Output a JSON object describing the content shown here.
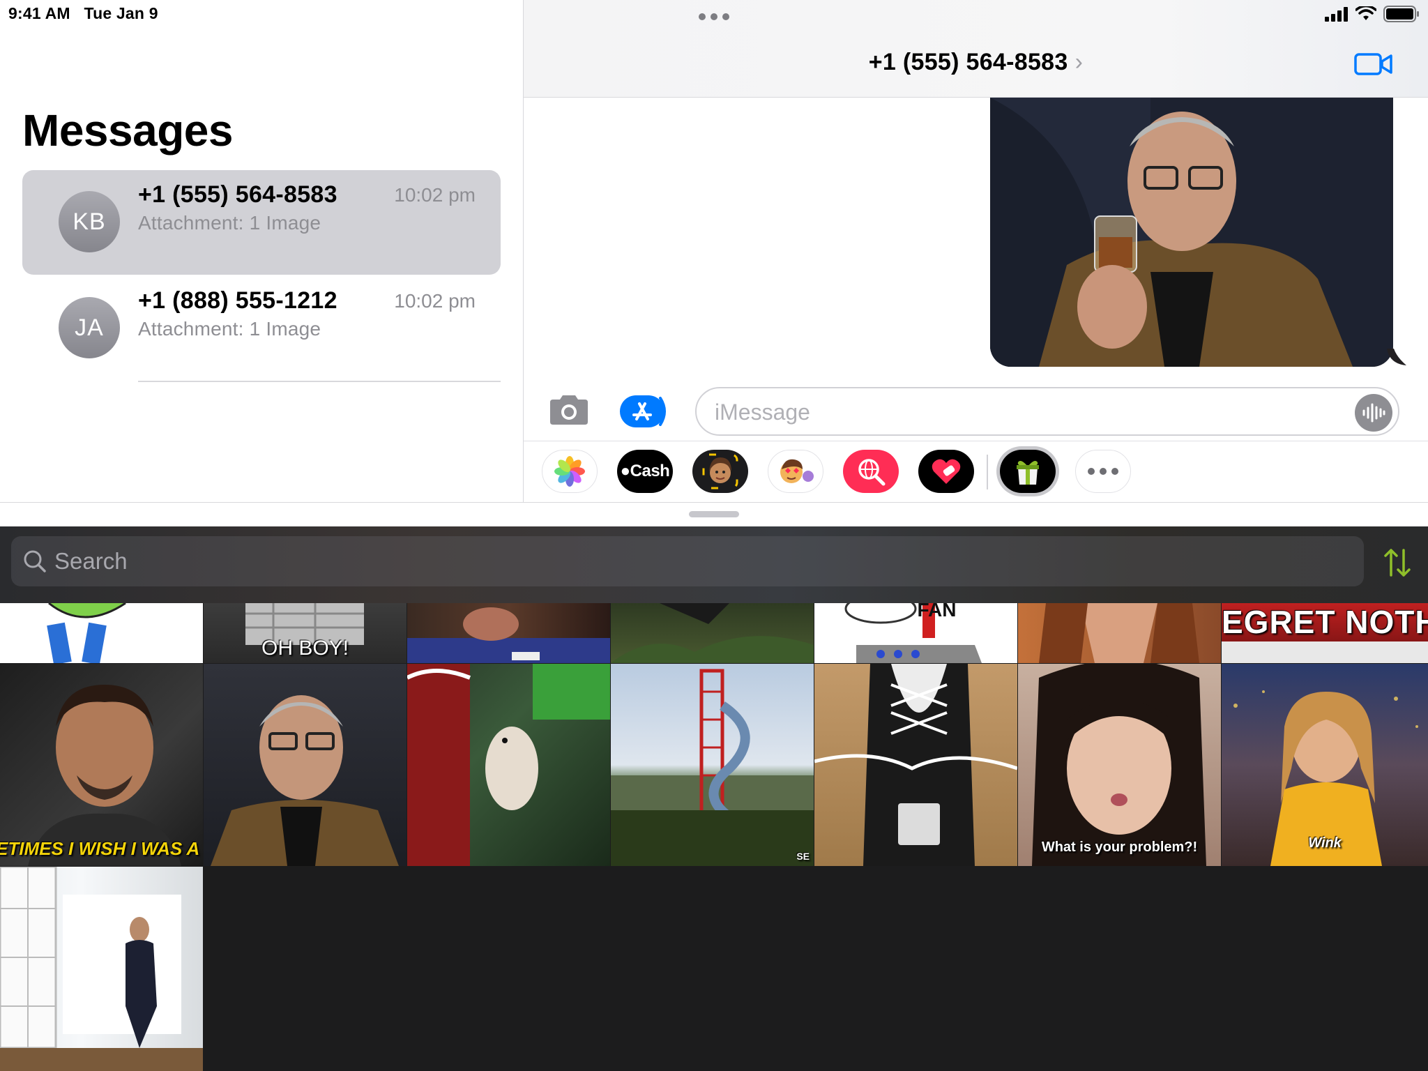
{
  "status_bar": {
    "time": "9:41 AM",
    "date": "Tue Jan 9",
    "icons": [
      "cellular-signal-icon",
      "wifi-icon",
      "battery-icon"
    ]
  },
  "sidebar": {
    "title": "Messages",
    "conversations": [
      {
        "initials": "KB",
        "name": "+1 (555) 564-8583",
        "time": "10:02 pm",
        "preview": "Attachment: 1 Image",
        "selected": true
      },
      {
        "initials": "JA",
        "name": "+1 (888) 555-1212",
        "time": "10:02 pm",
        "preview": "Attachment: 1 Image",
        "selected": false
      }
    ]
  },
  "conversation": {
    "title": "+1 (555) 564-8583",
    "title_chevron": "›",
    "input_placeholder": "iMessage",
    "apps": [
      {
        "name": "photos-app-icon"
      },
      {
        "name": "apple-cash-app-icon",
        "label": "Cash"
      },
      {
        "name": "memoji-app-icon"
      },
      {
        "name": "memoji-stickers-app-icon"
      },
      {
        "name": "images-search-app-icon"
      },
      {
        "name": "digital-touch-app-icon"
      },
      {
        "name": "gif-app-icon"
      },
      {
        "name": "more-apps-icon"
      }
    ]
  },
  "gif_drawer": {
    "search_placeholder": "Search",
    "captions": {
      "oh_boy": "OH BOY!",
      "fan": "FAN",
      "regret": "EGRET NOTH",
      "sometimes": "ETIMES I WISH I WAS A LI",
      "problem": "What is your problem?!",
      "wink": "Wink",
      "se": "SE"
    }
  },
  "colors": {
    "accent_blue": "#007aff",
    "selected_row": "#d1d1d6",
    "drawer_bg": "#1c1c1d",
    "sort_icon": "#8fbf2a"
  }
}
